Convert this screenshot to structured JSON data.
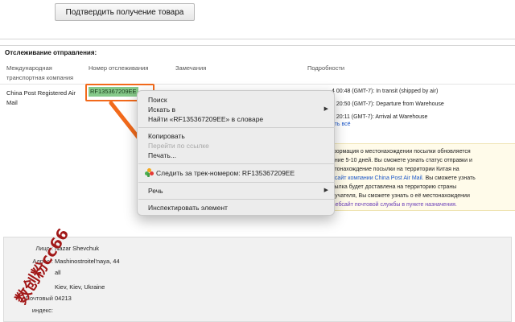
{
  "confirm_button": "Подтвердить получение товара",
  "section_title": "Отслеживание отправления:",
  "columns": {
    "carrier": [
      "Международная",
      "транспортная компания"
    ],
    "tracking": "Номер отслеживания",
    "notes": "Замечания",
    "details": "Подробности"
  },
  "row": {
    "carrier": [
      "China Post Registered Air",
      "Mail"
    ],
    "tracking_number": "RF135367209EE"
  },
  "details": [
    "4 00:48 (GMT-7): In transit (shipped by air)",
    "3 20:50 (GMT-7): Departure from Warehouse",
    "3 20:11 (GMT-7): Arrival at Warehouse"
  ],
  "show_all": "еть всё",
  "info": {
    "l1": "формация о местонахождении посылки обновляется",
    "l2": "ение 5-10 дней. Вы сможете узнать статус отправки и",
    "l3": "стонахождение посылки на территории Китая на",
    "l4_link": "бсайт компании China Post Air Mail.",
    "l4_rest": " Вы сможете узнать",
    "l5": "сылка будет доставлена на территорию страны",
    "l6": "лучателя, Вы сможете узнать о её местонахождении",
    "l7_link": "Вебсайт почтовой службы в пункте назначения."
  },
  "context_menu": {
    "search": "Поиск",
    "search_in": "Искать в",
    "find": "Найти «RF135367209EE» в словаре",
    "copy": "Копировать",
    "open_link": "Перейти по ссылке",
    "print": "Печать...",
    "track": "Следить за трек-номером: RF135367209EE",
    "speech": "Речь",
    "inspect": "Инспектировать элемент"
  },
  "address": {
    "name_label": "Лицо :",
    "name_value": "Nazar Shevchuk",
    "addr_label": "Адрес :",
    "addr_value": "Mashinostroitel'naya, 44",
    "addr_value2": "all",
    "city_value": "Kiev, Kiev, Ukraine",
    "postal_label": "Почтовый",
    "postal_value": "04213",
    "index_label": "индекс:"
  },
  "watermark": "数创粉cc66",
  "colors": {
    "accent_orange": "#f26a1b",
    "link_blue": "#1a56c8",
    "highlight_green": "#86c98a",
    "watermark_red": "#a11818"
  }
}
